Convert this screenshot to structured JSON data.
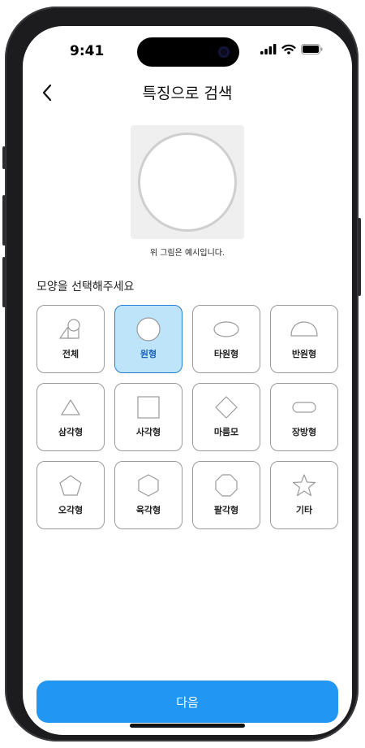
{
  "status_bar": {
    "time": "9:41"
  },
  "header": {
    "title": "특징으로 검색"
  },
  "preview": {
    "caption": "위 그림은 예시입니다."
  },
  "shape_section": {
    "label": "모양을 선택해주세요",
    "selected": "원형",
    "items": [
      {
        "label": "전체",
        "icon": "all-shapes-icon"
      },
      {
        "label": "원형",
        "icon": "circle-icon"
      },
      {
        "label": "타원형",
        "icon": "oval-icon"
      },
      {
        "label": "반원형",
        "icon": "semicircle-icon"
      },
      {
        "label": "삼각형",
        "icon": "triangle-icon"
      },
      {
        "label": "사각형",
        "icon": "square-icon"
      },
      {
        "label": "마름모",
        "icon": "diamond-icon"
      },
      {
        "label": "장방형",
        "icon": "rounded-rectangle-icon"
      },
      {
        "label": "오각형",
        "icon": "pentagon-icon"
      },
      {
        "label": "육각형",
        "icon": "hexagon-icon"
      },
      {
        "label": "팔각형",
        "icon": "octagon-icon"
      },
      {
        "label": "기타",
        "icon": "star-icon"
      }
    ]
  },
  "footer": {
    "next_label": "다음"
  },
  "colors": {
    "accent": "#2196f3",
    "selected_bg": "#bde4f8",
    "selected_border": "#2a7fd6"
  }
}
